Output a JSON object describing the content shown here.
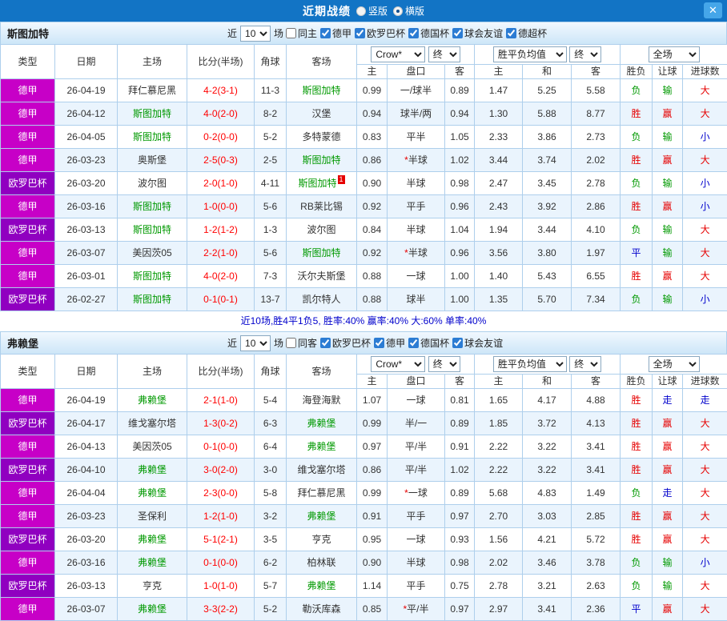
{
  "titlebar": {
    "title": "近期战绩",
    "radio_vertical": "竖版",
    "radio_horizontal": "横版",
    "close_label": "✕"
  },
  "league_colors": {
    "德甲": "#c700c7",
    "欧罗巴杯": "#9000c0"
  },
  "result_colors": {
    "胜": "#e60000",
    "赢": "#e60000",
    "大": "#e60000",
    "负": "#009900",
    "输": "#009900",
    "平": "#0000cc",
    "走": "#0000cc",
    "小": "#0000cc"
  },
  "sections": [
    {
      "team": "斯图加特",
      "filter": {
        "near": "近",
        "count": "10",
        "games": "场",
        "same": {
          "label": "同主",
          "checked": false
        },
        "leagues": [
          {
            "label": "德甲",
            "checked": true
          },
          {
            "label": "欧罗巴杯",
            "checked": true
          },
          {
            "label": "德国杯",
            "checked": true
          },
          {
            "label": "球会友谊",
            "checked": true
          },
          {
            "label": "德超杯",
            "checked": true
          }
        ]
      },
      "header": {
        "type": "类型",
        "date": "日期",
        "home": "主场",
        "score": "比分(半场)",
        "corner": "角球",
        "away": "客场",
        "odds_company": "Crow*",
        "odds_final": "终",
        "avg": "胜平负均值",
        "avg_final": "终",
        "scope": "全场",
        "sub": [
          "主",
          "盘口",
          "客",
          "主",
          "和",
          "客",
          "胜负",
          "让球",
          "进球数"
        ]
      },
      "rows": [
        {
          "league": "德甲",
          "date": "26-04-19",
          "home": "拜仁慕尼黑",
          "home_hl": false,
          "score": "4-2(3-1)",
          "corner": "11-3",
          "away": "斯图加特",
          "away_hl": true,
          "away_badge": "",
          "odds_home": "0.99",
          "handicap": "一/球半",
          "odds_away": "0.89",
          "avg_home": "1.47",
          "avg_draw": "5.25",
          "avg_away": "5.58",
          "results": [
            "负",
            "输",
            "大"
          ]
        },
        {
          "league": "德甲",
          "date": "26-04-12",
          "home": "斯图加特",
          "home_hl": true,
          "score": "4-0(2-0)",
          "corner": "8-2",
          "away": "汉堡",
          "away_hl": false,
          "away_badge": "",
          "odds_home": "0.94",
          "handicap": "球半/两",
          "odds_away": "0.94",
          "avg_home": "1.30",
          "avg_draw": "5.88",
          "avg_away": "8.77",
          "results": [
            "胜",
            "赢",
            "大"
          ]
        },
        {
          "league": "德甲",
          "date": "26-04-05",
          "home": "斯图加特",
          "home_hl": true,
          "score": "0-2(0-0)",
          "corner": "5-2",
          "away": "多特蒙德",
          "away_hl": false,
          "away_badge": "",
          "odds_home": "0.83",
          "handicap": "平半",
          "odds_away": "1.05",
          "avg_home": "2.33",
          "avg_draw": "3.86",
          "avg_away": "2.73",
          "results": [
            "负",
            "输",
            "小"
          ]
        },
        {
          "league": "德甲",
          "date": "26-03-23",
          "home": "奥斯堡",
          "home_hl": false,
          "score": "2-5(0-3)",
          "corner": "2-5",
          "away": "斯图加特",
          "away_hl": true,
          "away_badge": "",
          "odds_home": "0.86",
          "handicap": "*半球",
          "odds_away": "1.02",
          "avg_home": "3.44",
          "avg_draw": "3.74",
          "avg_away": "2.02",
          "results": [
            "胜",
            "赢",
            "大"
          ]
        },
        {
          "league": "欧罗巴杯",
          "date": "26-03-20",
          "home": "波尔图",
          "home_hl": false,
          "score": "2-0(1-0)",
          "corner": "4-11",
          "away": "斯图加特",
          "away_hl": true,
          "away_badge": "1",
          "odds_home": "0.90",
          "handicap": "半球",
          "odds_away": "0.98",
          "avg_home": "2.47",
          "avg_draw": "3.45",
          "avg_away": "2.78",
          "results": [
            "负",
            "输",
            "小"
          ]
        },
        {
          "league": "德甲",
          "date": "26-03-16",
          "home": "斯图加特",
          "home_hl": true,
          "score": "1-0(0-0)",
          "corner": "5-6",
          "away": "RB莱比锡",
          "away_hl": false,
          "away_badge": "",
          "odds_home": "0.92",
          "handicap": "平手",
          "odds_away": "0.96",
          "avg_home": "2.43",
          "avg_draw": "3.92",
          "avg_away": "2.86",
          "results": [
            "胜",
            "赢",
            "小"
          ]
        },
        {
          "league": "欧罗巴杯",
          "date": "26-03-13",
          "home": "斯图加特",
          "home_hl": true,
          "score": "1-2(1-2)",
          "corner": "1-3",
          "away": "波尔图",
          "away_hl": false,
          "away_badge": "",
          "odds_home": "0.84",
          "handicap": "半球",
          "odds_away": "1.04",
          "avg_home": "1.94",
          "avg_draw": "3.44",
          "avg_away": "4.10",
          "results": [
            "负",
            "输",
            "大"
          ]
        },
        {
          "league": "德甲",
          "date": "26-03-07",
          "home": "美因茨05",
          "home_hl": false,
          "score": "2-2(1-0)",
          "corner": "5-6",
          "away": "斯图加特",
          "away_hl": true,
          "away_badge": "",
          "odds_home": "0.92",
          "handicap": "*半球",
          "odds_away": "0.96",
          "avg_home": "3.56",
          "avg_draw": "3.80",
          "avg_away": "1.97",
          "results": [
            "平",
            "输",
            "大"
          ]
        },
        {
          "league": "德甲",
          "date": "26-03-01",
          "home": "斯图加特",
          "home_hl": true,
          "score": "4-0(2-0)",
          "corner": "7-3",
          "away": "沃尔夫斯堡",
          "away_hl": false,
          "away_badge": "",
          "odds_home": "0.88",
          "handicap": "一球",
          "odds_away": "1.00",
          "avg_home": "1.40",
          "avg_draw": "5.43",
          "avg_away": "6.55",
          "results": [
            "胜",
            "赢",
            "大"
          ]
        },
        {
          "league": "欧罗巴杯",
          "date": "26-02-27",
          "home": "斯图加特",
          "home_hl": true,
          "score": "0-1(0-1)",
          "corner": "13-7",
          "away": "凯尔特人",
          "away_hl": false,
          "away_badge": "",
          "odds_home": "0.88",
          "handicap": "球半",
          "odds_away": "1.00",
          "avg_home": "1.35",
          "avg_draw": "5.70",
          "avg_away": "7.34",
          "results": [
            "负",
            "输",
            "小"
          ]
        }
      ],
      "summary": "近10场,胜4平1负5, 胜率:40% 赢率:40% 大:60% 单率:40%"
    },
    {
      "team": "弗赖堡",
      "filter": {
        "near": "近",
        "count": "10",
        "games": "场",
        "same": {
          "label": "同客",
          "checked": false
        },
        "leagues": [
          {
            "label": "欧罗巴杯",
            "checked": true
          },
          {
            "label": "德甲",
            "checked": true
          },
          {
            "label": "德国杯",
            "checked": true
          },
          {
            "label": "球会友谊",
            "checked": true
          }
        ]
      },
      "header": {
        "type": "类型",
        "date": "日期",
        "home": "主场",
        "score": "比分(半场)",
        "corner": "角球",
        "away": "客场",
        "odds_company": "Crow*",
        "odds_final": "终",
        "avg": "胜平负均值",
        "avg_final": "终",
        "scope": "全场",
        "sub": [
          "主",
          "盘口",
          "客",
          "主",
          "和",
          "客",
          "胜负",
          "让球",
          "进球数"
        ]
      },
      "rows": [
        {
          "league": "德甲",
          "date": "26-04-19",
          "home": "弗赖堡",
          "home_hl": true,
          "score": "2-1(1-0)",
          "corner": "5-4",
          "away": "海登海默",
          "away_hl": false,
          "away_badge": "",
          "odds_home": "1.07",
          "handicap": "一球",
          "odds_away": "0.81",
          "avg_home": "1.65",
          "avg_draw": "4.17",
          "avg_away": "4.88",
          "results": [
            "胜",
            "走",
            "走"
          ]
        },
        {
          "league": "欧罗巴杯",
          "date": "26-04-17",
          "home": "维戈塞尔塔",
          "home_hl": false,
          "score": "1-3(0-2)",
          "corner": "6-3",
          "away": "弗赖堡",
          "away_hl": true,
          "away_badge": "",
          "odds_home": "0.99",
          "handicap": "半/一",
          "odds_away": "0.89",
          "avg_home": "1.85",
          "avg_draw": "3.72",
          "avg_away": "4.13",
          "results": [
            "胜",
            "赢",
            "大"
          ]
        },
        {
          "league": "德甲",
          "date": "26-04-13",
          "home": "美因茨05",
          "home_hl": false,
          "score": "0-1(0-0)",
          "corner": "6-4",
          "away": "弗赖堡",
          "away_hl": true,
          "away_badge": "",
          "odds_home": "0.97",
          "handicap": "平/半",
          "odds_away": "0.91",
          "avg_home": "2.22",
          "avg_draw": "3.22",
          "avg_away": "3.41",
          "results": [
            "胜",
            "赢",
            "大"
          ]
        },
        {
          "league": "欧罗巴杯",
          "date": "26-04-10",
          "home": "弗赖堡",
          "home_hl": true,
          "score": "3-0(2-0)",
          "corner": "3-0",
          "away": "维戈塞尔塔",
          "away_hl": false,
          "away_badge": "",
          "odds_home": "0.86",
          "handicap": "平/半",
          "odds_away": "1.02",
          "avg_home": "2.22",
          "avg_draw": "3.22",
          "avg_away": "3.41",
          "results": [
            "胜",
            "赢",
            "大"
          ]
        },
        {
          "league": "德甲",
          "date": "26-04-04",
          "home": "弗赖堡",
          "home_hl": true,
          "score": "2-3(0-0)",
          "corner": "5-8",
          "away": "拜仁慕尼黑",
          "away_hl": false,
          "away_badge": "",
          "odds_home": "0.99",
          "handicap": "*一球",
          "odds_away": "0.89",
          "avg_home": "5.68",
          "avg_draw": "4.83",
          "avg_away": "1.49",
          "results": [
            "负",
            "走",
            "大"
          ]
        },
        {
          "league": "德甲",
          "date": "26-03-23",
          "home": "圣保利",
          "home_hl": false,
          "score": "1-2(1-0)",
          "corner": "3-2",
          "away": "弗赖堡",
          "away_hl": true,
          "away_badge": "",
          "odds_home": "0.91",
          "handicap": "平手",
          "odds_away": "0.97",
          "avg_home": "2.70",
          "avg_draw": "3.03",
          "avg_away": "2.85",
          "results": [
            "胜",
            "赢",
            "大"
          ]
        },
        {
          "league": "欧罗巴杯",
          "date": "26-03-20",
          "home": "弗赖堡",
          "home_hl": true,
          "score": "5-1(2-1)",
          "corner": "3-5",
          "away": "亨克",
          "away_hl": false,
          "away_badge": "",
          "odds_home": "0.95",
          "handicap": "一球",
          "odds_away": "0.93",
          "avg_home": "1.56",
          "avg_draw": "4.21",
          "avg_away": "5.72",
          "results": [
            "胜",
            "赢",
            "大"
          ]
        },
        {
          "league": "德甲",
          "date": "26-03-16",
          "home": "弗赖堡",
          "home_hl": true,
          "score": "0-1(0-0)",
          "corner": "6-2",
          "away": "柏林联",
          "away_hl": false,
          "away_badge": "",
          "odds_home": "0.90",
          "handicap": "半球",
          "odds_away": "0.98",
          "avg_home": "2.02",
          "avg_draw": "3.46",
          "avg_away": "3.78",
          "results": [
            "负",
            "输",
            "小"
          ]
        },
        {
          "league": "欧罗巴杯",
          "date": "26-03-13",
          "home": "亨克",
          "home_hl": false,
          "score": "1-0(1-0)",
          "corner": "5-7",
          "away": "弗赖堡",
          "away_hl": true,
          "away_badge": "",
          "odds_home": "1.14",
          "handicap": "平手",
          "odds_away": "0.75",
          "avg_home": "2.78",
          "avg_draw": "3.21",
          "avg_away": "2.63",
          "results": [
            "负",
            "输",
            "大"
          ]
        },
        {
          "league": "德甲",
          "date": "26-03-07",
          "home": "弗赖堡",
          "home_hl": true,
          "score": "3-3(2-2)",
          "corner": "5-2",
          "away": "勒沃库森",
          "away_hl": false,
          "away_badge": "",
          "odds_home": "0.85",
          "handicap": "*平/半",
          "odds_away": "0.97",
          "avg_home": "2.97",
          "avg_draw": "3.41",
          "avg_away": "2.36",
          "results": [
            "平",
            "赢",
            "大"
          ]
        }
      ],
      "summary": ""
    }
  ]
}
